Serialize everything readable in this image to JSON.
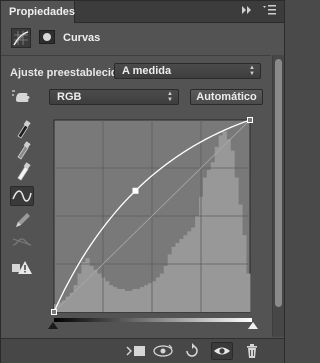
{
  "panel": {
    "tab_label": "Propiedades",
    "tab_expand_icon": "double-chevron-right-icon",
    "tab_menu_icon": "panel-menu-icon"
  },
  "header": {
    "title": "Curvas",
    "adjustment_icon": "curves-adjustment-icon",
    "mask_icon": "layer-mask-icon"
  },
  "preset": {
    "label": "Ajuste preestablecido:",
    "value": "A medida"
  },
  "channel": {
    "value": "RGB",
    "auto_label": "Automático"
  },
  "tools": [
    "on-image-adjust-hand-icon",
    "black-point-eyedropper-icon",
    "gray-point-eyedropper-icon",
    "white-point-eyedropper-icon",
    "edit-points-curve-icon",
    "draw-pencil-icon",
    "smooth-curve-icon",
    "clipping-warning-icon"
  ],
  "chart_data": {
    "type": "line",
    "title": "",
    "xlabel": "",
    "ylabel": "",
    "xlim": [
      0,
      255
    ],
    "ylim": [
      0,
      255
    ],
    "grid": true,
    "curve_points": [
      {
        "x": 0,
        "y": 0
      },
      {
        "x": 106,
        "y": 161
      },
      {
        "x": 255,
        "y": 255
      }
    ],
    "histogram": [
      0.04,
      0.05,
      0.06,
      0.08,
      0.1,
      0.14,
      0.2,
      0.26,
      0.28,
      0.24,
      0.22,
      0.2,
      0.18,
      0.16,
      0.14,
      0.13,
      0.12,
      0.12,
      0.11,
      0.11,
      0.12,
      0.12,
      0.13,
      0.14,
      0.15,
      0.16,
      0.18,
      0.2,
      0.24,
      0.3,
      0.34,
      0.36,
      0.38,
      0.4,
      0.42,
      0.44,
      0.5,
      0.6,
      0.7,
      0.74,
      0.78,
      0.86,
      0.92,
      0.94,
      0.9,
      0.84,
      0.7,
      0.56,
      0.4,
      0.2
    ]
  },
  "footer": {
    "icons": [
      "clip-to-layer-icon",
      "view-previous-state-icon",
      "reset-icon",
      "toggle-visibility-eye-icon",
      "trash-icon"
    ]
  },
  "colors": {
    "panel_bg": "#535353",
    "graph_bg": "#797979",
    "histogram": "#989898",
    "curve": "#ffffff"
  }
}
